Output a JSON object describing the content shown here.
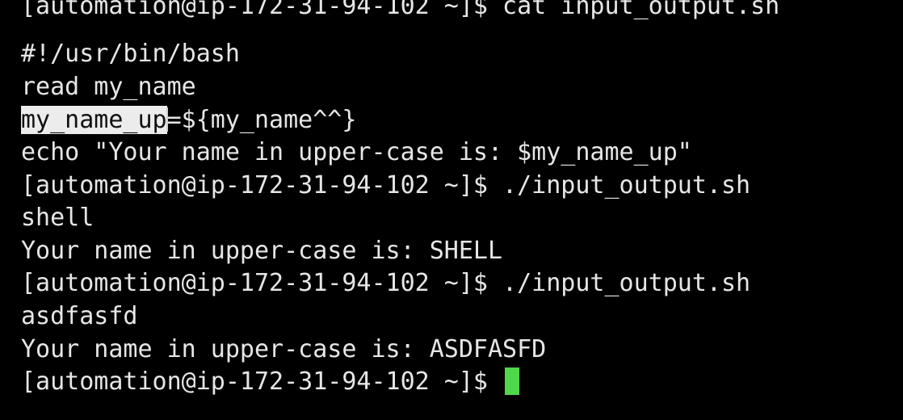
{
  "terminal": {
    "colors": {
      "background": "#000000",
      "foreground": "#e6e6e6",
      "selection_bg": "#ececec",
      "selection_fg": "#111111",
      "cursor": "#4fd84a"
    },
    "partial_top_line": "[automation@ip-172-31-94-102 ~]$ cat input_output.sh",
    "lines": [
      "#!/usr/bin/bash",
      "read my_name",
      "echo \"Your name in upper-case is: $my_name_up\"",
      "[automation@ip-172-31-94-102 ~]$ ./input_output.sh",
      "shell",
      "Your name in upper-case is: SHELL",
      "[automation@ip-172-31-94-102 ~]$ ./input_output.sh",
      "asdfasfd",
      "Your name in upper-case is: ASDFASFD"
    ],
    "highlight_line": {
      "selected": "my_name_up",
      "rest": "=${my_name^^}"
    },
    "prompt": "[automation@ip-172-31-94-102 ~]$ "
  }
}
